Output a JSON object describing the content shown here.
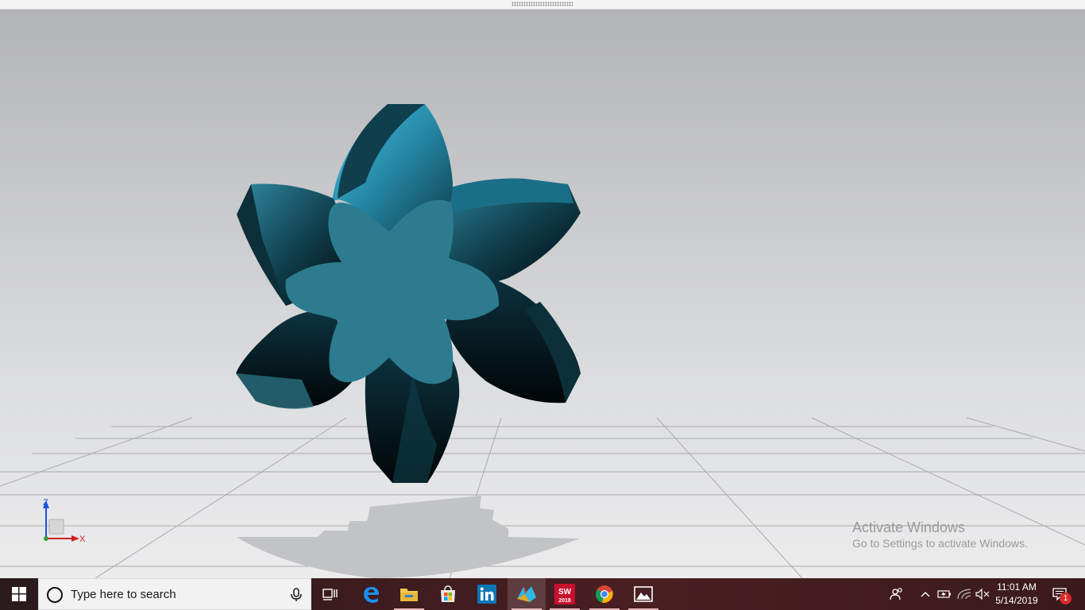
{
  "viewport": {
    "triad": {
      "z_label": "Z",
      "x_label": "X"
    },
    "watermark": {
      "title": "Activate Windows",
      "subtitle": "Go to Settings to activate Windows."
    }
  },
  "colors": {
    "part": "#2c7b8e",
    "part_dark": "#072028",
    "part_highlight": "#3fbfe6",
    "taskbar": "#3d1c1f",
    "axis_z": "#1f4fe0",
    "axis_x": "#d02020"
  },
  "taskbar": {
    "search_placeholder": "Type here to search",
    "apps": [
      {
        "name": "task-view",
        "icon": "task-view-icon"
      },
      {
        "name": "edge",
        "icon": "edge-icon"
      },
      {
        "name": "file-explorer",
        "icon": "folder-icon"
      },
      {
        "name": "store",
        "icon": "store-icon"
      },
      {
        "name": "linkedin",
        "icon": "linkedin-icon"
      },
      {
        "name": "nx",
        "icon": "nx-app-icon"
      },
      {
        "name": "solidworks",
        "icon": "solidworks-icon",
        "badge": "2018"
      },
      {
        "name": "chrome",
        "icon": "chrome-icon"
      },
      {
        "name": "photos",
        "icon": "photos-icon"
      }
    ],
    "clock": {
      "time": "11:01 AM",
      "date": "5/14/2019"
    },
    "notification_count": "1"
  }
}
